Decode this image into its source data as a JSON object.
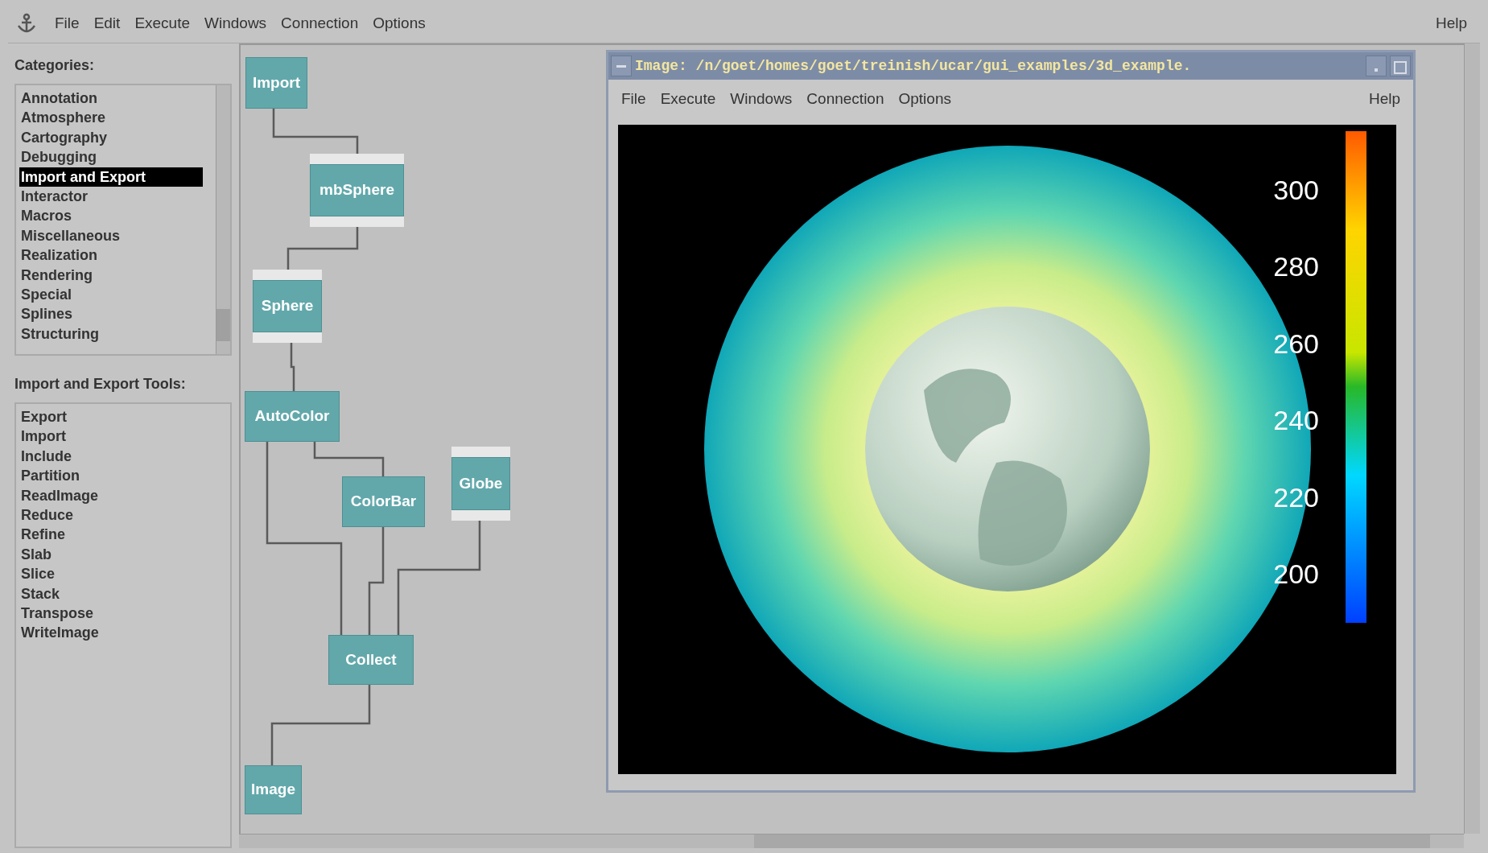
{
  "menu_bar": {
    "items": [
      "File",
      "Edit",
      "Execute",
      "Windows",
      "Connection",
      "Options"
    ],
    "help": "Help"
  },
  "categories": {
    "label": "Categories:",
    "items": [
      {
        "text": "Annotation",
        "selected": false
      },
      {
        "text": "Atmosphere",
        "selected": false
      },
      {
        "text": "Cartography",
        "selected": false
      },
      {
        "text": "Debugging",
        "selected": false
      },
      {
        "text": "Import and Export",
        "selected": true
      },
      {
        "text": "Interactor",
        "selected": false
      },
      {
        "text": "Macros",
        "selected": false
      },
      {
        "text": "Miscellaneous",
        "selected": false
      },
      {
        "text": "Realization",
        "selected": false
      },
      {
        "text": "Rendering",
        "selected": false
      },
      {
        "text": "Special",
        "selected": false
      },
      {
        "text": "Splines",
        "selected": false
      },
      {
        "text": "Structuring",
        "selected": false
      }
    ]
  },
  "tools": {
    "label": "Import and Export Tools:",
    "items": [
      "Export",
      "Import",
      "Include",
      "Partition",
      "ReadImage",
      "Reduce",
      "Refine",
      "Slab",
      "Slice",
      "Stack",
      "Transpose",
      "WriteImage"
    ]
  },
  "network": {
    "nodes": [
      {
        "label": "Import",
        "banded": false
      },
      {
        "label": "mbSphere",
        "banded": true
      },
      {
        "label": "Sphere",
        "banded": true
      },
      {
        "label": "AutoColor",
        "banded": false
      },
      {
        "label": "ColorBar",
        "banded": false
      },
      {
        "label": "Globe",
        "banded": true
      },
      {
        "label": "Collect",
        "banded": false
      },
      {
        "label": "Image",
        "banded": false
      }
    ]
  },
  "image_window": {
    "title": "Image: /n/goet/homes/goet/treinish/ucar/gui_examples/3d_example.",
    "menu_items": [
      "File",
      "Execute",
      "Windows",
      "Connection",
      "Options"
    ],
    "help": "Help",
    "colorbar": {
      "labels": [
        "300",
        "280",
        "260",
        "240",
        "220",
        "200"
      ]
    }
  }
}
